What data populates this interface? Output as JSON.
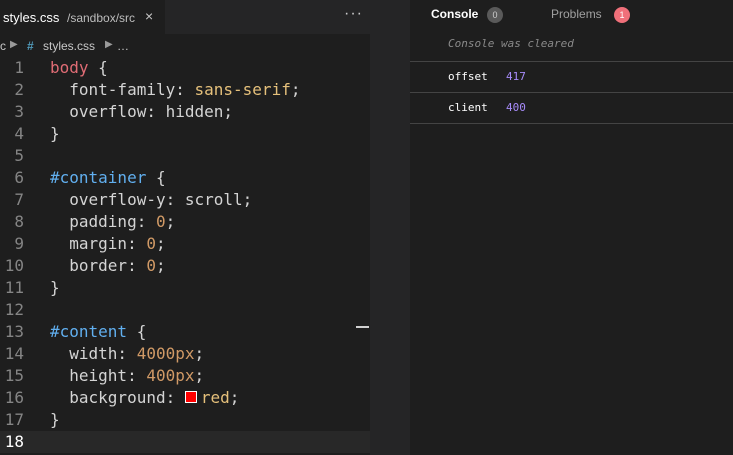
{
  "editor": {
    "tab": {
      "filename": "styles.css",
      "path": "/sandbox/src",
      "close": "×"
    },
    "more": "···",
    "breadcrumb": {
      "folder": "c",
      "hash": "#",
      "file": "styles.css",
      "more": "…",
      "sep": "▶"
    },
    "lines": [
      {
        "n": "1",
        "tokens": [
          {
            "c": "t-sel",
            "t": "body"
          },
          {
            "c": "t-punc",
            "t": " {"
          }
        ]
      },
      {
        "n": "2",
        "tokens": [
          {
            "c": "t-prop",
            "t": "  font-family: "
          },
          {
            "c": "t-str",
            "t": "sans-serif"
          },
          {
            "c": "t-punc",
            "t": ";"
          }
        ]
      },
      {
        "n": "3",
        "tokens": [
          {
            "c": "t-prop",
            "t": "  overflow: "
          },
          {
            "c": "t-val",
            "t": "hidden"
          },
          {
            "c": "t-punc",
            "t": ";"
          }
        ]
      },
      {
        "n": "4",
        "tokens": [
          {
            "c": "t-punc",
            "t": "}"
          }
        ]
      },
      {
        "n": "5",
        "tokens": []
      },
      {
        "n": "6",
        "tokens": [
          {
            "c": "t-id",
            "t": "#container"
          },
          {
            "c": "t-punc",
            "t": " {"
          }
        ]
      },
      {
        "n": "7",
        "tokens": [
          {
            "c": "t-prop",
            "t": "  overflow-y: "
          },
          {
            "c": "t-val",
            "t": "scroll"
          },
          {
            "c": "t-punc",
            "t": ";"
          }
        ]
      },
      {
        "n": "8",
        "tokens": [
          {
            "c": "t-prop",
            "t": "  padding: "
          },
          {
            "c": "t-num",
            "t": "0"
          },
          {
            "c": "t-punc",
            "t": ";"
          }
        ]
      },
      {
        "n": "9",
        "tokens": [
          {
            "c": "t-prop",
            "t": "  margin: "
          },
          {
            "c": "t-num",
            "t": "0"
          },
          {
            "c": "t-punc",
            "t": ";"
          }
        ]
      },
      {
        "n": "10",
        "tokens": [
          {
            "c": "t-prop",
            "t": "  border: "
          },
          {
            "c": "t-num",
            "t": "0"
          },
          {
            "c": "t-punc",
            "t": ";"
          }
        ]
      },
      {
        "n": "11",
        "tokens": [
          {
            "c": "t-punc",
            "t": "}"
          }
        ]
      },
      {
        "n": "12",
        "tokens": []
      },
      {
        "n": "13",
        "tokens": [
          {
            "c": "t-id",
            "t": "#content"
          },
          {
            "c": "t-punc",
            "t": " {"
          }
        ]
      },
      {
        "n": "14",
        "tokens": [
          {
            "c": "t-prop",
            "t": "  width: "
          },
          {
            "c": "t-num",
            "t": "4000px"
          },
          {
            "c": "t-punc",
            "t": ";"
          }
        ]
      },
      {
        "n": "15",
        "tokens": [
          {
            "c": "t-prop",
            "t": "  height: "
          },
          {
            "c": "t-num",
            "t": "400px"
          },
          {
            "c": "t-punc",
            "t": ";"
          }
        ]
      },
      {
        "n": "16",
        "tokens": [
          {
            "c": "t-prop",
            "t": "  background: "
          },
          {
            "c": "swatch",
            "t": ""
          },
          {
            "c": "t-str",
            "t": "red"
          },
          {
            "c": "t-punc",
            "t": ";"
          }
        ]
      },
      {
        "n": "17",
        "tokens": [
          {
            "c": "t-punc",
            "t": "}"
          }
        ]
      },
      {
        "n": "18",
        "tokens": [],
        "current": true
      }
    ]
  },
  "panel": {
    "tabs": {
      "console": "Console",
      "console_count": "0",
      "problems": "Problems",
      "problems_count": "1"
    },
    "cleared_message": "Console was cleared",
    "logs": [
      {
        "key": "offset",
        "value": "417"
      },
      {
        "key": "client",
        "value": "400"
      }
    ]
  },
  "colors": {
    "swatch": "#ff0000",
    "problems_badge": "#f0707a",
    "log_value": "#a78bfa"
  }
}
